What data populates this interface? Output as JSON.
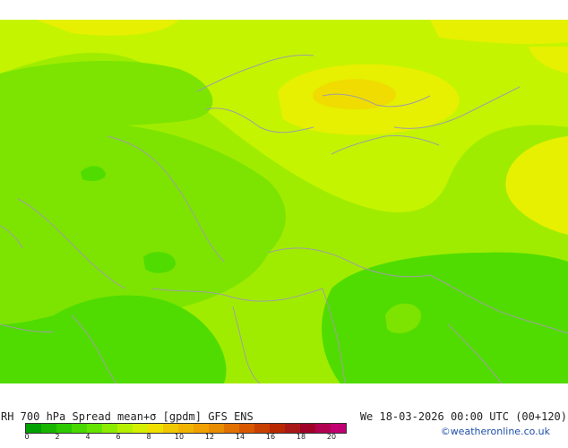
{
  "title": {
    "left": "RH 700 hPa Spread mean+σ [gpdm] GFS ENS",
    "right": "We 18-03-2026 00:00 UTC (00+120)"
  },
  "credit": "©weatheronline.co.uk",
  "legend": {
    "colors": [
      "#00a000",
      "#18b400",
      "#2cc800",
      "#48d800",
      "#64e400",
      "#8cec00",
      "#b4f000",
      "#d4f000",
      "#f0e000",
      "#f0c800",
      "#f0b400",
      "#f0a000",
      "#e88c00",
      "#e07000",
      "#d85800",
      "#c84000",
      "#b82800",
      "#a81818",
      "#a00028",
      "#b00050",
      "#c00070"
    ],
    "ticks": [
      "0",
      "2",
      "4",
      "6",
      "8",
      "10",
      "12",
      "14",
      "16",
      "18",
      "20"
    ]
  },
  "map": {
    "field_colors": {
      "low": "#50dc00",
      "mid_low": "#7ce400",
      "mid": "#a0ec00",
      "mid_high": "#c4f400",
      "high": "#e6f000",
      "peak": "#f0dc00"
    },
    "border_color": "#a0a0a0"
  }
}
